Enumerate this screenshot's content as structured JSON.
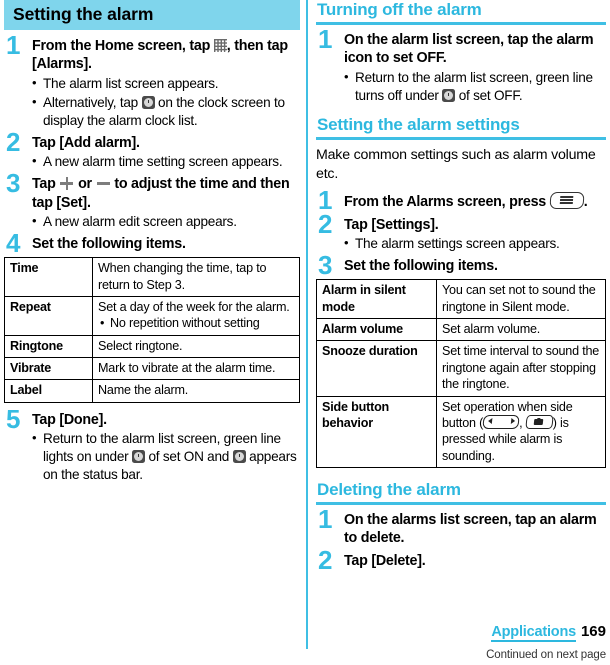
{
  "page": {
    "number": "169",
    "chapter": "Applications",
    "continued": "Continued on next page"
  },
  "left_column": {
    "section_title": "Setting the alarm",
    "steps": [
      {
        "num": "1",
        "title_before_icon": "From the Home screen, tap ",
        "icon": "apps-grid-icon",
        "title_after_icon": ", then tap [Alarms].",
        "bullets": [
          {
            "text": "The alarm list screen appears."
          },
          {
            "before_icon": "Alternatively, tap ",
            "icon": "clock-icon",
            "after_icon": " on the clock screen to display the alarm clock list."
          }
        ]
      },
      {
        "num": "2",
        "title": "Tap [Add alarm].",
        "bullets": [
          {
            "text": "A new alarm time setting screen appears."
          }
        ]
      },
      {
        "num": "3",
        "title_part1": "Tap ",
        "icon1": "plus-icon",
        "title_part2": " or ",
        "icon2": "minus-icon",
        "title_part3": " to adjust the time and then tap [Set].",
        "bullets": [
          {
            "text": "A new alarm edit screen appears."
          }
        ]
      },
      {
        "num": "4",
        "title": "Set the following items."
      },
      {
        "num": "5",
        "title": "Tap [Done].",
        "bullets": [
          {
            "before_icon": "Return to the alarm list screen, green line lights on under ",
            "icon": "clock-icon",
            "mid": " of set ON and ",
            "icon2": "clock-icon",
            "after_icon": " appears on the status bar."
          }
        ]
      }
    ],
    "table": {
      "rows": [
        {
          "key": "Time",
          "value": "When changing the time, tap to return to Step 3."
        },
        {
          "key": "Repeat",
          "value": "Set a day of the week for the alarm.",
          "subbullet": "No repetition without setting"
        },
        {
          "key": "Ringtone",
          "value": "Select ringtone."
        },
        {
          "key": "Vibrate",
          "value": "Mark to vibrate at the alarm time."
        },
        {
          "key": "Label",
          "value": "Name the alarm."
        }
      ]
    }
  },
  "right_column": {
    "section1": {
      "title": "Turning off the alarm",
      "steps": [
        {
          "num": "1",
          "title": "On the alarm list screen, tap the alarm icon to set OFF.",
          "bullets": [
            {
              "before_icon": "Return to the alarm list screen, green line turns off under ",
              "icon": "clock-icon",
              "after_icon": " of set OFF."
            }
          ]
        }
      ]
    },
    "section2": {
      "title": "Setting the alarm settings",
      "intro": "Make common settings such as alarm volume etc.",
      "steps": [
        {
          "num": "1",
          "title_before_icon": "From the Alarms screen, press ",
          "icon": "menu-key-icon",
          "title_after_icon": "."
        },
        {
          "num": "2",
          "title": "Tap [Settings].",
          "bullets": [
            {
              "text": "The alarm settings screen appears."
            }
          ]
        },
        {
          "num": "3",
          "title": "Set the following items."
        }
      ],
      "table": {
        "rows": [
          {
            "key": "Alarm in silent mode",
            "value": "You can set not to sound the ringtone in Silent mode."
          },
          {
            "key": "Alarm volume",
            "value": "Set alarm volume."
          },
          {
            "key": "Snooze duration",
            "value": "Set time interval to sound the ringtone again after stopping the ringtone."
          },
          {
            "key": "Side button behavior",
            "value_part1": "Set operation when side button (",
            "icon1": "volume-key-icon",
            "value_part2": ", ",
            "icon2": "camera-key-icon",
            "value_part3": ") is pressed while alarm is sounding."
          }
        ]
      }
    },
    "section3": {
      "title": "Deleting the alarm",
      "steps": [
        {
          "num": "1",
          "title": "On the alarms list screen, tap an alarm to delete."
        },
        {
          "num": "2",
          "title": "Tap [Delete]."
        }
      ]
    }
  },
  "colors": {
    "band": "#7FD5EC",
    "accent": "#2DB8DF",
    "rule": "#3FBFE4"
  }
}
